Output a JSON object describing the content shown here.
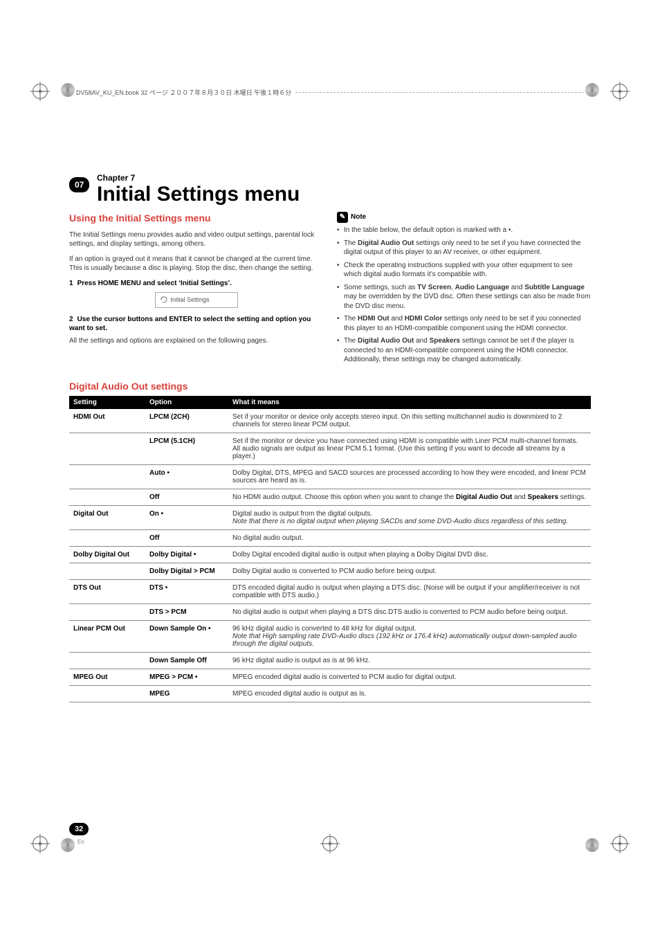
{
  "book_header": "DV58AV_KU_EN.book  32 ページ  ２００７年８月３０日  木曜日  午後１時６分",
  "chapter_badge": "07",
  "chapter_label": "Chapter 7",
  "page_title": "Initial Settings menu",
  "h2_using": "Using the Initial Settings menu",
  "intro_1": "The Initial Settings menu provides audio and video output settings, parental lock settings, and display settings, among others.",
  "intro_2": "If an option is grayed out it means that it cannot be changed at the current time. This is usually because a disc is playing. Stop the disc, then change the setting.",
  "step1_num": "1",
  "step1_text": "Press HOME MENU and select ‘Initial Settings’.",
  "box_text": "Initial Settings",
  "step2_num": "2",
  "step2_text": "Use the cursor buttons and ENTER to select the setting and option you want to set.",
  "after_step2": "All the settings and options are explained on the following pages.",
  "note_label": "Note",
  "note_items": [
    "In the table below, the default option is marked with a •.",
    "The <strong>Digital Audio Out</strong> settings only need to be set if you have connected the digital output of this player to an AV receiver, or other equipment.",
    "Check the operating instructions supplied with your other equipment to see which digital audio formats it’s compatible with.",
    "Some settings, such as <strong>TV Screen</strong>, <strong>Audio Language</strong> and <strong>Subtitle Language</strong> may be overridden by the DVD disc. Often these settings can also be made from the DVD disc menu.",
    "The <strong>HDMI Out</strong> and <strong>HDMI Color</strong> settings only need to be set if you connected this player to an HDMI-compatible component using the HDMI connector.",
    "The <strong>Digital Audio Out</strong> and <strong>Speakers</strong> settings cannot be set if the player is connected to an HDMI-compatible component using the HDMI connector. Additionally, these settings may be changed automatically."
  ],
  "h2_digital": "Digital Audio Out settings",
  "table_headers": {
    "c1": "Setting",
    "c2": "Option",
    "c3": "What it means"
  },
  "rows": [
    {
      "setting": "HDMI Out",
      "option": "LPCM (2CH)",
      "desc": "Set if your monitor or device only accepts stereo input. On this setting multichannel audio is downmixed to 2 channels for stereo linear PCM output."
    },
    {
      "setting": "",
      "option": "LPCM (5.1CH)",
      "desc": "Set if the monitor or device you have connected using HDMI is compatible with Liner PCM multi-channel formats. All audio signals are output as linear PCM 5.1 format. (Use this setting if you want to decode all streams by a player.)"
    },
    {
      "setting": "",
      "option": "Auto •",
      "desc": "Dolby Digital, DTS, MPEG and SACD sources are processed according to how they were encoded, and linear PCM sources are heard as is."
    },
    {
      "setting": "",
      "option": "Off",
      "desc": "No HDMI audio output. Choose this option when you want to change the <strong>Digital Audio Out</strong> and <strong>Speakers</strong> settings."
    },
    {
      "setting": "Digital Out",
      "option": "On •",
      "desc": "Digital audio is output from the digital outputs.<br><em>Note that there is no digital output when playing SACDs and some DVD-Audio discs regardless of this setting.</em>"
    },
    {
      "setting": "",
      "option": "Off",
      "desc": "No digital audio output."
    },
    {
      "setting": "Dolby Digital Out",
      "option": "Dolby Digital •",
      "desc": "Dolby Digital encoded digital audio is output when playing a Dolby Digital DVD disc."
    },
    {
      "setting": "",
      "option": "Dolby Digital > PCM",
      "desc": "Dolby Digital audio is converted to PCM audio before being output."
    },
    {
      "setting": "DTS Out",
      "option": "DTS •",
      "desc": "DTS encoded digital audio is output when playing a DTS disc. (Noise will be output if your amplifier/receiver is not compatible with DTS audio.)"
    },
    {
      "setting": "",
      "option": "DTS > PCM",
      "desc": "No digital audio is output when playing a DTS disc.DTS audio is converted to PCM audio before being output."
    },
    {
      "setting": "Linear PCM Out",
      "option": "Down Sample On •",
      "desc": "96 kHz digital audio is converted to 48 kHz for digital output.<br><em> Note that High sampling rate DVD-Audio discs (192 kHz or 176.4 kHz) automatically output down-sampled audio through the digital outputs.</em>"
    },
    {
      "setting": "",
      "option": "Down Sample Off",
      "desc": "96 kHz digital audio is output as is at 96 kHz."
    },
    {
      "setting": "MPEG Out",
      "option": "MPEG > PCM •",
      "desc": "MPEG encoded digital audio is converted to PCM audio for digital output."
    },
    {
      "setting": "",
      "option": "MPEG",
      "desc": "MPEG encoded digital audio is output as is."
    }
  ],
  "page_number": "32",
  "page_lang": "En"
}
